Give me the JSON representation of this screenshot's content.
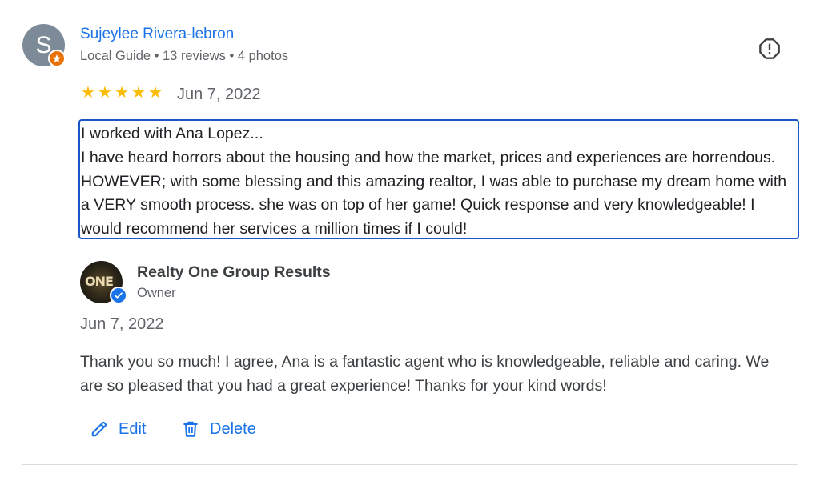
{
  "reviewer": {
    "initial": "S",
    "name": "Sujeylee Rivera-lebron",
    "meta": "Local Guide • 13 reviews • 4 photos"
  },
  "review": {
    "rating": 5,
    "date": "Jun 7, 2022",
    "text": "I worked with Ana Lopez...\nI have heard horrors about the housing and how the market, prices and experiences are horrendous. HOWEVER; with some blessing and this amazing realtor, I was able to purchase my dream home with a VERY smooth process. she was on top of her game! Quick response and very knowledgeable! I would recommend her services a million times if I could!"
  },
  "owner_response": {
    "logo_text": "ONE",
    "name": "Realty One Group Results",
    "role": "Owner",
    "date": "Jun 7, 2022",
    "text": "Thank you so much! I agree, Ana is a fantastic agent who is knowledgeable, reliable and caring. We are so pleased that you had a great experience! Thanks for your kind words!"
  },
  "actions": {
    "edit_label": "Edit",
    "delete_label": "Delete"
  },
  "colors": {
    "link": "#1a73e8",
    "star": "#fbbc04",
    "avatar_bg": "#7c8b97",
    "local_guide_badge": "#e8710a",
    "focus_border": "#1a56c7"
  },
  "icons": {
    "report": "report-flag-icon",
    "edit": "pencil-icon",
    "delete": "trash-icon",
    "verified": "verified-check-icon",
    "local_guide": "local-guide-star-icon",
    "star": "star-icon"
  }
}
